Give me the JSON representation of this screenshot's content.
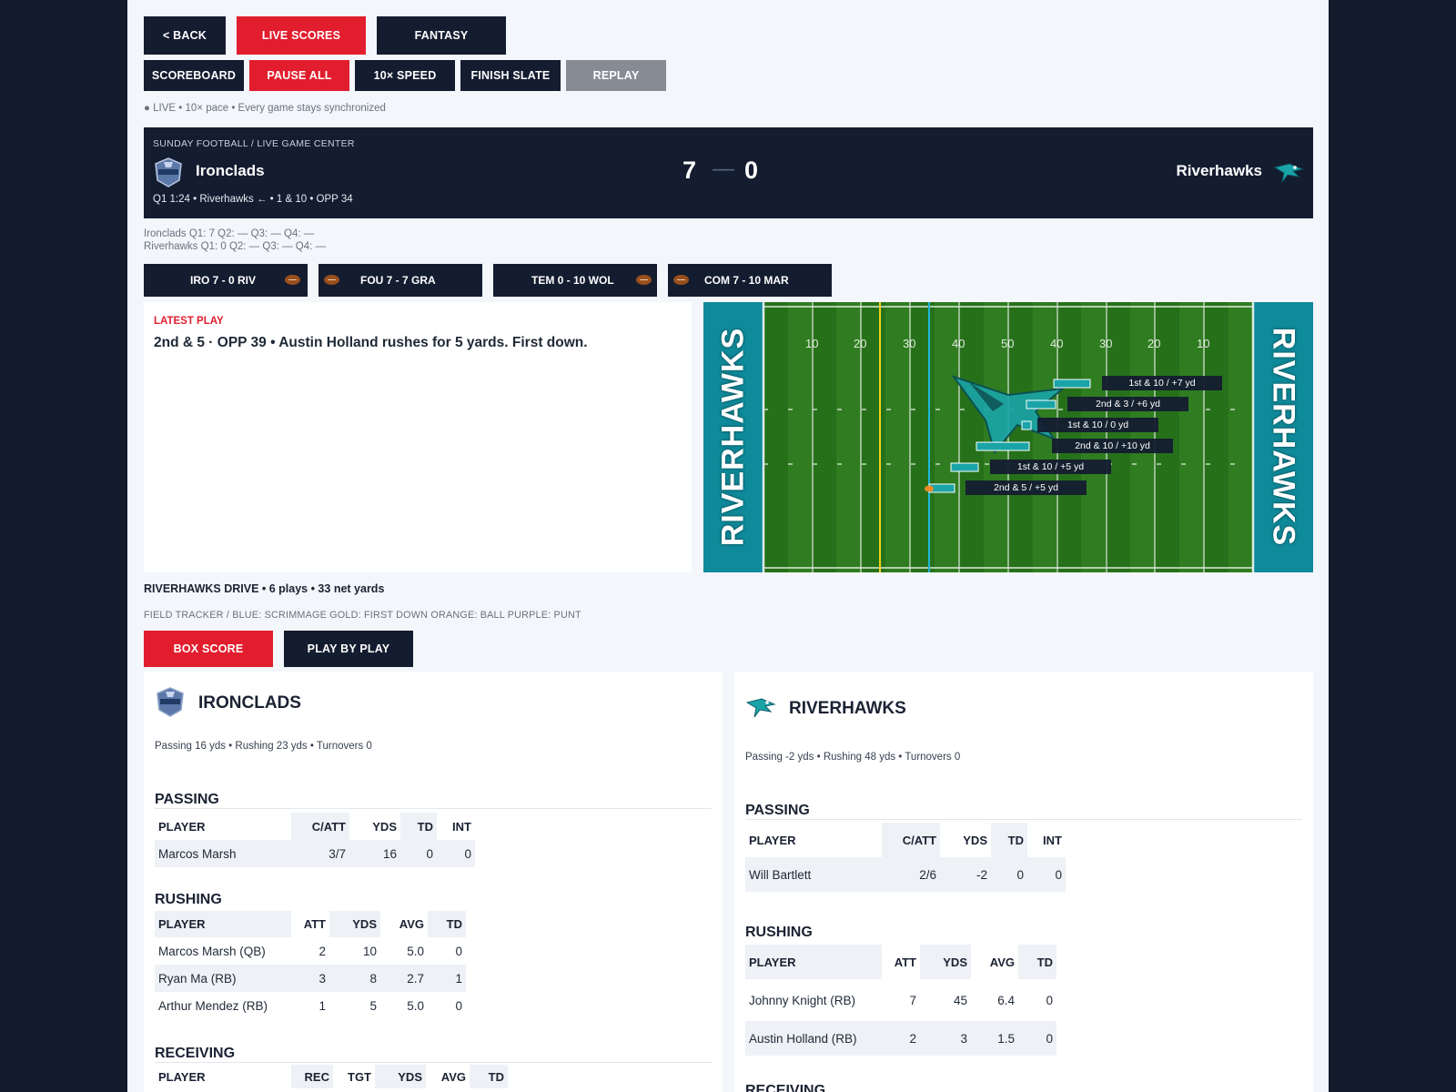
{
  "nav": {
    "back": "< BACK",
    "live_scores": "LIVE SCORES",
    "fantasy": "FANTASY"
  },
  "controls": {
    "scoreboard": "SCOREBOARD",
    "pause_all": "PAUSE ALL",
    "speed": "10× SPEED",
    "finish_slate": "FINISH SLATE",
    "replay": "REPLAY"
  },
  "status_line": "● LIVE • 10× pace • Every game stays synchronized",
  "header": {
    "breadcrumb": "SUNDAY FOOTBALL   /   LIVE GAME CENTER",
    "home": {
      "name": "Ironclads",
      "score": "7"
    },
    "away": {
      "name": "Riverhawks",
      "score": "0"
    },
    "score_separator": "—",
    "situation": "Q1  1:24   •   Riverhawks ←   •   1 & 10   •   OPP 34"
  },
  "quarters": {
    "home": "Ironclads   Q1: 7   Q2: —   Q3: —   Q4: —",
    "away": "Riverhawks   Q1: 0   Q2: —   Q3: —   Q4: —"
  },
  "ticker": [
    {
      "label": "IRO 7  -  0 RIV"
    },
    {
      "label": "FOU 7  -  7 GRA"
    },
    {
      "label": "TEM 0  -  10 WOL"
    },
    {
      "label": "COM 7  -  10 MAR"
    }
  ],
  "latest_play": {
    "label": "LATEST PLAY",
    "text": "2nd & 5 · OPP 39  •  Austin Holland rushes for 5 yards. First down."
  },
  "field": {
    "endzone_text": "RIVERHAWKS",
    "yard_numbers": [
      "10",
      "20",
      "30",
      "40",
      "50",
      "40",
      "30",
      "20",
      "10"
    ],
    "plays": [
      "1st & 10  /  +7 yd",
      "2nd & 3  /  +6 yd",
      "1st & 10  /  0 yd",
      "2nd & 10  /  +10 yd",
      "1st & 10  /  +5 yd",
      "2nd & 5  /  +5 yd"
    ]
  },
  "drive": "RIVERHAWKS DRIVE   •   6 plays   •   33 net yards",
  "legend": "FIELD TRACKER   /   BLUE: SCRIMMAGE    GOLD: FIRST DOWN    ORANGE: BALL    PURPLE: PUNT",
  "tabs": {
    "box_score": "BOX SCORE",
    "play_by_play": "PLAY BY PLAY"
  },
  "colors": {
    "navy": "#141c30",
    "red": "#e11d2e",
    "field_green": "#2f7d20",
    "teal": "#0f8a9a"
  },
  "box": {
    "home": {
      "name": "IRONCLADS",
      "summary": "Passing 16 yds • Rushing 23 yds • Turnovers 0",
      "passing": {
        "title": "PASSING",
        "headers": [
          "PLAYER",
          "C/ATT",
          "YDS",
          "TD",
          "INT"
        ],
        "rows": [
          [
            "Marcos Marsh",
            "3/7",
            "16",
            "0",
            "0"
          ]
        ]
      },
      "rushing": {
        "title": "RUSHING",
        "headers": [
          "PLAYER",
          "ATT",
          "YDS",
          "AVG",
          "TD"
        ],
        "rows": [
          [
            "Marcos Marsh (QB)",
            "2",
            "10",
            "5.0",
            "0"
          ],
          [
            "Ryan Ma (RB)",
            "3",
            "8",
            "2.7",
            "1"
          ],
          [
            "Arthur Mendez (RB)",
            "1",
            "5",
            "5.0",
            "0"
          ]
        ]
      },
      "receiving": {
        "title": "RECEIVING",
        "headers": [
          "PLAYER",
          "REC",
          "TGT",
          "YDS",
          "AVG",
          "TD"
        ]
      }
    },
    "away": {
      "name": "RIVERHAWKS",
      "summary": "Passing -2 yds • Rushing 48 yds • Turnovers 0",
      "passing": {
        "title": "PASSING",
        "headers": [
          "PLAYER",
          "C/ATT",
          "YDS",
          "TD",
          "INT"
        ],
        "rows": [
          [
            "Will Bartlett",
            "2/6",
            "-2",
            "0",
            "0"
          ]
        ]
      },
      "rushing": {
        "title": "RUSHING",
        "headers": [
          "PLAYER",
          "ATT",
          "YDS",
          "AVG",
          "TD"
        ],
        "rows": [
          [
            "Johnny Knight (RB)",
            "7",
            "45",
            "6.4",
            "0"
          ],
          [
            "Austin Holland (RB)",
            "2",
            "3",
            "1.5",
            "0"
          ]
        ]
      },
      "receiving": {
        "title": "RECEIVING"
      }
    }
  }
}
